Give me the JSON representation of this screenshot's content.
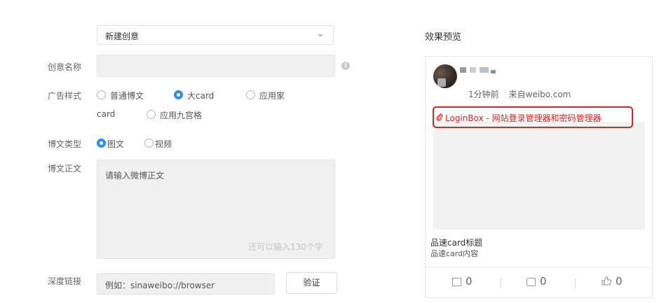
{
  "form": {
    "select_value": "新建创意",
    "name_label": "创意名称",
    "style_label": "广告样式",
    "style_options": [
      "普通博文",
      "大card",
      "应用家",
      "card",
      "应用九宫格"
    ],
    "type_label": "博文类型",
    "type_options": [
      "图文",
      "视频"
    ],
    "body_label": "博文正文",
    "body_placeholder": "请输入微博正文",
    "body_counter": "还可以输入130个字",
    "link_label": "深度链接",
    "link_placeholder": "例如：sinaweibo://browser",
    "verify_label": "验证"
  },
  "preview": {
    "title": "效果预览",
    "time": "1分钟前",
    "source": "来自weibo.com",
    "link_text": "LoginBox - 网站登录管理器和密码管理器",
    "card_title": "品速card标题",
    "card_content": "品速card内容",
    "repost_count": "0",
    "comment_count": "0",
    "like_count": "0"
  },
  "colors": {
    "accent_blue": "#2d8cf0",
    "highlight_red": "#e02020"
  },
  "icons": {
    "info": "info-icon",
    "clip": "paperclip-icon",
    "repost": "repost-icon",
    "comment": "comment-icon",
    "like": "thumbs-up-icon"
  }
}
